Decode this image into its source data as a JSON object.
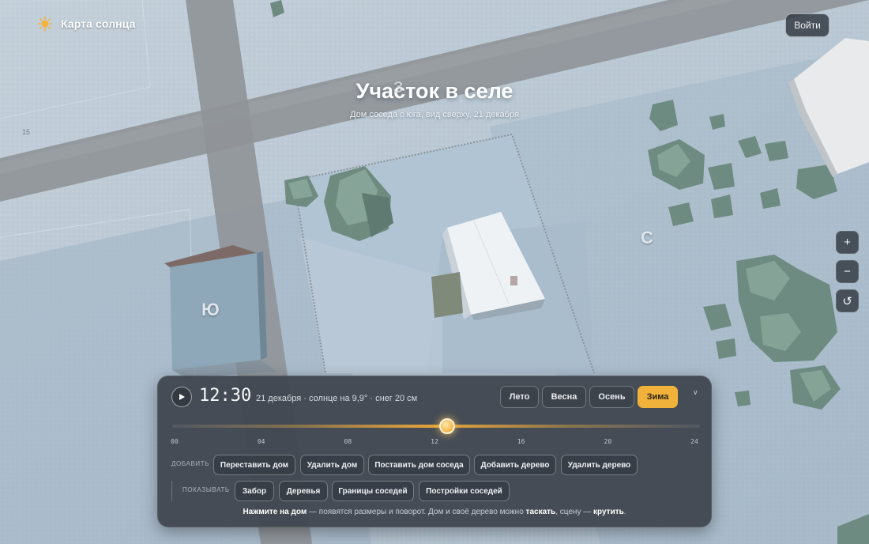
{
  "header": {
    "brand_title": "Карта солнца",
    "brand_icon": "sun-icon",
    "login_label": "Войти"
  },
  "hero": {
    "title": "Участок в селе",
    "subtitle": "Дом соседа с юга, вид сверху, 21 декабря"
  },
  "map": {
    "directions": {
      "south": "Ю",
      "north": "С",
      "west": "З"
    },
    "plot_number": "15",
    "controls": {
      "zoom_in": "+",
      "zoom_out": "−",
      "reset": "↺"
    }
  },
  "panel": {
    "time": "12:30",
    "info": "21 декабря · солнце на 9,9° · снег 20 см",
    "seasons": [
      {
        "label": "Лето",
        "active": false
      },
      {
        "label": "Весна",
        "active": false
      },
      {
        "label": "Осень",
        "active": false
      },
      {
        "label": "Зима",
        "active": true
      }
    ],
    "collapse": "v",
    "timeline": {
      "ticks": [
        "00",
        "04",
        "08",
        "12",
        "16",
        "20",
        "24"
      ],
      "value_hours": 12.5,
      "min": 0,
      "max": 24
    },
    "add_label": "ДОБАВИТЬ",
    "add_actions": [
      "Переставить дом",
      "Удалить дом",
      "Поставить дом соседа",
      "Добавить дерево",
      "Удалить дерево"
    ],
    "show_label": "ПОКАЗЫВАТЬ",
    "show_toggles": [
      "Забор",
      "Деревья",
      "Границы соседей",
      "Постройки соседей"
    ],
    "hint": {
      "part1": "Нажмите на дом",
      "part2": " — появятся размеры и поворот. Дом и своё дерево можно ",
      "part3": "таскать",
      "part4": ", сцену — ",
      "part5": "крутить",
      "part6": "."
    }
  },
  "colors": {
    "accent": "#f0b23a",
    "panel": "#3f464f",
    "snow": "#b7c6d3",
    "road": "#8e9298",
    "tree": "#7f9c90"
  }
}
